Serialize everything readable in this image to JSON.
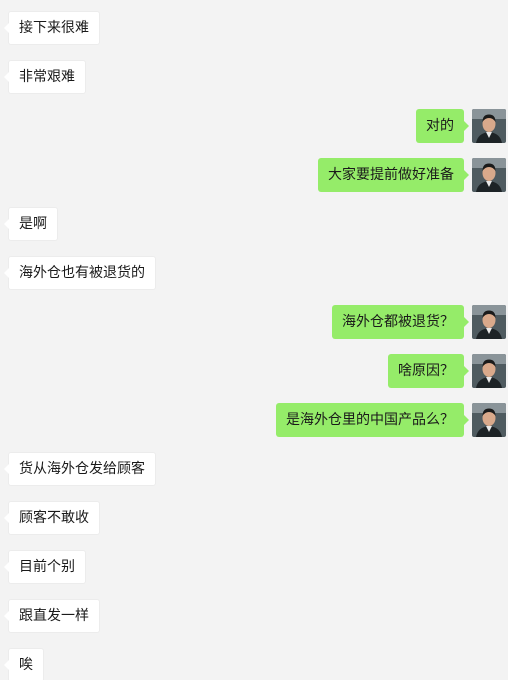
{
  "colors": {
    "background": "#f3f3f3",
    "incoming_bubble": "#ffffff",
    "outgoing_bubble": "#95ec69"
  },
  "messages": [
    {
      "side": "left",
      "text": "接下来很难"
    },
    {
      "side": "left",
      "text": "非常艰难"
    },
    {
      "side": "right",
      "text": "对的"
    },
    {
      "side": "right",
      "text": "大家要提前做好准备"
    },
    {
      "side": "left",
      "text": "是啊"
    },
    {
      "side": "left",
      "text": "海外仓也有被退货的"
    },
    {
      "side": "right",
      "text": "海外仓都被退货？"
    },
    {
      "side": "right",
      "text": "啥原因？"
    },
    {
      "side": "right",
      "text": "是海外仓里的中国产品么？"
    },
    {
      "side": "left",
      "text": "货从海外仓发给顾客"
    },
    {
      "side": "left",
      "text": "顾客不敢收"
    },
    {
      "side": "left",
      "text": "目前个别"
    },
    {
      "side": "left",
      "text": "跟直发一样"
    },
    {
      "side": "left",
      "text": "唉"
    }
  ]
}
